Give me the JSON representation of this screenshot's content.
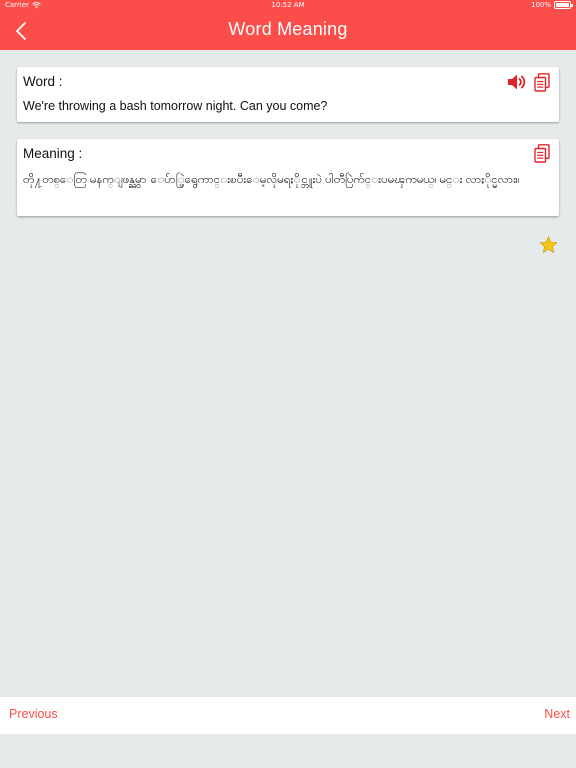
{
  "status_bar": {
    "carrier": "Carrier",
    "time": "10:52 AM",
    "battery": "100%"
  },
  "nav": {
    "title": "Word Meaning",
    "back_icon": "chevron-left-icon"
  },
  "word_card": {
    "label": "Word :",
    "text": "We're throwing a bash tomorrow night. Can you come?",
    "icons": [
      "speaker-icon",
      "copy-icon"
    ]
  },
  "meaning_card": {
    "label": "Meaning :",
    "text": "တို႔တစ္ေတြ မနက္ျဖန္ညမွာ ေပ်ာ္ပြဲရွေကာင္းၿပီးေမ့လိုမရႏိုင္ဘူးပဲ ပါတီပြဲက်င္းပမၾကမယ္၊ မင္း လာႏိုင္မလား။",
    "icons": [
      "copy-icon"
    ]
  },
  "favorite": {
    "icon": "star-icon"
  },
  "bottom_bar": {
    "previous_label": "Previous",
    "next_label": "Next"
  },
  "colors": {
    "accent": "#fb4e4a",
    "background": "#e6eaea",
    "icon_red": "#e0242a",
    "star": "#f5c518"
  }
}
